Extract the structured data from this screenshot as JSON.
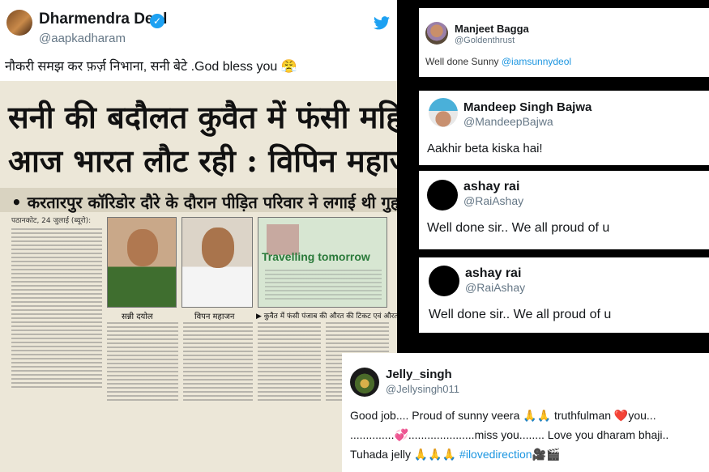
{
  "main_tweet": {
    "name": "Dharmendra Deol",
    "handle": "@aapkadharam",
    "text": "नौकरी समझ कर फ़र्ज़ निभाना, सनी बेटे .God bless you 😤",
    "verified_icon": "verified-badge-icon",
    "twitter_icon": "twitter-bird-icon",
    "newspaper": {
      "headline_line1": "सनी की बदौलत कुवैत में फंसी महिला",
      "headline_line2": "आज भारत लौट रही : विपिन महाजन",
      "subhead": "• करतारपुर कॉरिडोर दौरे के दौरान पीड़ित परिवार ने लगाई थी गुहार",
      "dateline": "पठानकोट, 24 जुलाई (ब्यूरो):",
      "photo1_caption": "सन्नी दयोल",
      "photo2_caption": "विपन महाजन",
      "photo3_caption": "▶ कुवैत में फंसी पंजाब की औरत की टिकट एवं औरत दीपा।",
      "ticket_text": "Travelling tomorrow"
    }
  },
  "replies": [
    {
      "name": "Manjeet Bagga",
      "handle": "@Goldenthrust",
      "text": "Well done Sunny ",
      "mention": "@iamsunnydeol"
    },
    {
      "name": "Mandeep Singh Bajwa",
      "handle": "@MandeepBajwa",
      "text": "Aakhir beta kiska hai!"
    },
    {
      "name": "ashay rai",
      "handle": "@RaiAshay",
      "text": "Well done sir.. We all proud of u"
    },
    {
      "name": "ashay rai",
      "handle": "@RaiAshay",
      "text": "Well done sir.. We all proud of u"
    },
    {
      "name": "Jelly_singh",
      "handle": "@Jellysingh011",
      "line1": "Good job.... Proud of sunny veera 🙏🙏 truthfulman ❤️you...",
      "line2": "..............💞.....................miss you........ Love you dharam bhaji..",
      "line3_prefix": "Tuhada jelly 🙏🙏🙏 ",
      "hashtag": "#ilovedirection",
      "line3_suffix": "🎥🎬"
    }
  ]
}
